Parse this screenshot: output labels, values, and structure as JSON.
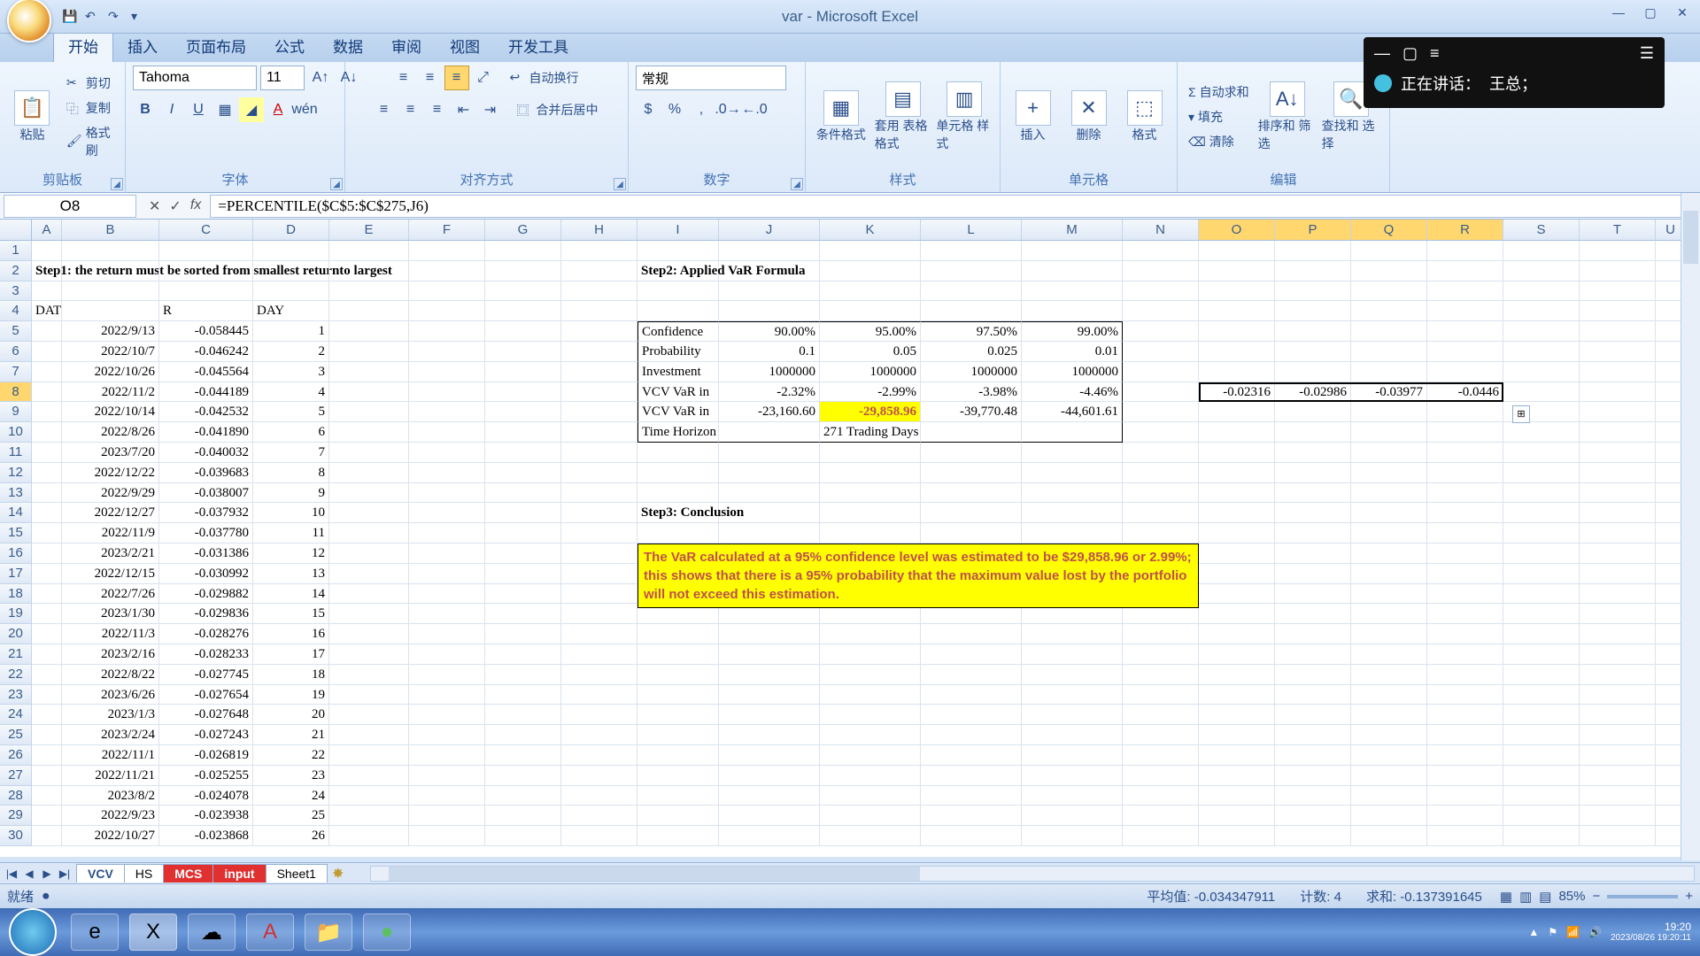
{
  "window": {
    "title": "var - Microsoft Excel"
  },
  "ribbon": {
    "tabs": [
      "开始",
      "插入",
      "页面布局",
      "公式",
      "数据",
      "审阅",
      "视图",
      "开发工具"
    ],
    "active_tab": 0,
    "clipboard": {
      "paste": "粘贴",
      "cut": "剪切",
      "copy": "复制",
      "fmtpaint": "格式刷",
      "label": "剪贴板"
    },
    "font": {
      "name": "Tahoma",
      "size": "11",
      "label": "字体"
    },
    "align": {
      "wrap": "自动换行",
      "merge": "合并后居中",
      "label": "对齐方式"
    },
    "number": {
      "format": "常规",
      "label": "数字"
    },
    "styles": {
      "condfmt": "条件格式",
      "tblstyle": "套用 表格格式",
      "cellstyle": "单元格 样式",
      "label": "样式"
    },
    "cells": {
      "insert": "插入",
      "delete": "删除",
      "format": "格式",
      "label": "单元格"
    },
    "editing": {
      "sum": "自动求和",
      "fill": "填充",
      "clear": "清除",
      "sort": "排序和 筛选",
      "find": "查找和 选择",
      "label": "编辑"
    }
  },
  "voice": {
    "speaking_label": "正在讲话：",
    "speaker": "王总；"
  },
  "namebox": "O8",
  "formula": "=PERCENTILE($C$5:$C$275,J6)",
  "cols": {
    "A": 34,
    "B": 110,
    "C": 106,
    "D": 86,
    "E": 90,
    "F": 86,
    "G": 86,
    "H": 86,
    "I": 92,
    "J": 114,
    "K": 114,
    "L": 114,
    "M": 114,
    "N": 86,
    "O": 86,
    "P": 86,
    "Q": 86,
    "R": 86,
    "S": 86,
    "T": 86,
    "U": 34
  },
  "headers": [
    "A",
    "B",
    "C",
    "D",
    "E",
    "F",
    "G",
    "H",
    "I",
    "J",
    "K",
    "L",
    "M",
    "N",
    "O",
    "P",
    "Q",
    "R",
    "S",
    "T",
    "U"
  ],
  "selected_cols": [
    "O",
    "P",
    "Q",
    "R"
  ],
  "selected_row": 8,
  "step1_title": "Step1: the return must be sorted from smallest returnto largest",
  "step2_title": "Step2: Applied VaR Formula",
  "step3_title": "Step3: Conclusion",
  "col_labels": {
    "date": "DATE",
    "r": "R",
    "day": "DAY"
  },
  "returns": [
    {
      "row": 5,
      "date": "2022/9/13",
      "r": "-0.058445",
      "day": "1"
    },
    {
      "row": 6,
      "date": "2022/10/7",
      "r": "-0.046242",
      "day": "2"
    },
    {
      "row": 7,
      "date": "2022/10/26",
      "r": "-0.045564",
      "day": "3"
    },
    {
      "row": 8,
      "date": "2022/11/2",
      "r": "-0.044189",
      "day": "4"
    },
    {
      "row": 9,
      "date": "2022/10/14",
      "r": "-0.042532",
      "day": "5"
    },
    {
      "row": 10,
      "date": "2022/8/26",
      "r": "-0.041890",
      "day": "6"
    },
    {
      "row": 11,
      "date": "2023/7/20",
      "r": "-0.040032",
      "day": "7"
    },
    {
      "row": 12,
      "date": "2022/12/22",
      "r": "-0.039683",
      "day": "8"
    },
    {
      "row": 13,
      "date": "2022/9/29",
      "r": "-0.038007",
      "day": "9"
    },
    {
      "row": 14,
      "date": "2022/12/27",
      "r": "-0.037932",
      "day": "10"
    },
    {
      "row": 15,
      "date": "2022/11/9",
      "r": "-0.037780",
      "day": "11"
    },
    {
      "row": 16,
      "date": "2023/2/21",
      "r": "-0.031386",
      "day": "12"
    },
    {
      "row": 17,
      "date": "2022/12/15",
      "r": "-0.030992",
      "day": "13"
    },
    {
      "row": 18,
      "date": "2022/7/26",
      "r": "-0.029882",
      "day": "14"
    },
    {
      "row": 19,
      "date": "2023/1/30",
      "r": "-0.029836",
      "day": "15"
    },
    {
      "row": 20,
      "date": "2022/11/3",
      "r": "-0.028276",
      "day": "16"
    },
    {
      "row": 21,
      "date": "2023/2/16",
      "r": "-0.028233",
      "day": "17"
    },
    {
      "row": 22,
      "date": "2022/8/22",
      "r": "-0.027745",
      "day": "18"
    },
    {
      "row": 23,
      "date": "2023/6/26",
      "r": "-0.027654",
      "day": "19"
    },
    {
      "row": 24,
      "date": "2023/1/3",
      "r": "-0.027648",
      "day": "20"
    },
    {
      "row": 25,
      "date": "2023/2/24",
      "r": "-0.027243",
      "day": "21"
    },
    {
      "row": 26,
      "date": "2022/11/1",
      "r": "-0.026819",
      "day": "22"
    },
    {
      "row": 27,
      "date": "2022/11/21",
      "r": "-0.025255",
      "day": "23"
    },
    {
      "row": 28,
      "date": "2023/8/2",
      "r": "-0.024078",
      "day": "24"
    },
    {
      "row": 29,
      "date": "2022/9/23",
      "r": "-0.023938",
      "day": "25"
    },
    {
      "row": 30,
      "date": "2022/10/27",
      "r": "-0.023868",
      "day": "26"
    }
  ],
  "var_table": {
    "rows": [
      {
        "label": "Confidence",
        "v": [
          "90.00%",
          "95.00%",
          "97.50%",
          "99.00%"
        ]
      },
      {
        "label": "Probability",
        "v": [
          "0.1",
          "0.05",
          "0.025",
          "0.01"
        ]
      },
      {
        "label": "Investment",
        "v": [
          "1000000",
          "1000000",
          "1000000",
          "1000000"
        ]
      },
      {
        "label": "VCV VaR in",
        "v": [
          "-2.32%",
          "-2.99%",
          "-3.98%",
          "-4.46%"
        ]
      },
      {
        "label": "VCV VaR in",
        "v": [
          "-23,160.60",
          "-29,858.96",
          "-39,770.48",
          "-44,601.61"
        ],
        "hl": 1
      },
      {
        "label": "Time Horizon",
        "v": [
          "",
          "271 Trading Days",
          "",
          ""
        ]
      }
    ]
  },
  "percentiles": [
    "-0.02316",
    "-0.02986",
    "-0.03977",
    "-0.0446"
  ],
  "conclusion": "The VaR calculated at a 95% confidence level was estimated to be $29,858.96 or 2.99%; this shows that there is a 95% probability that the maximum value lost by the portfolio will not exceed this estimation.",
  "sheet_tabs": [
    {
      "name": "VCV",
      "style": "green active"
    },
    {
      "name": "HS",
      "style": ""
    },
    {
      "name": "MCS",
      "style": "red"
    },
    {
      "name": "input",
      "style": "red"
    },
    {
      "name": "Sheet1",
      "style": ""
    }
  ],
  "status": {
    "ready": "就绪",
    "avg_label": "平均值:",
    "avg": "-0.034347911",
    "count_label": "计数:",
    "count": "4",
    "sum_label": "求和:",
    "sum": "-0.137391645",
    "zoom": "85%"
  },
  "taskbar": {
    "time": "19:20",
    "date": "2023/08/26 19:20:11"
  }
}
